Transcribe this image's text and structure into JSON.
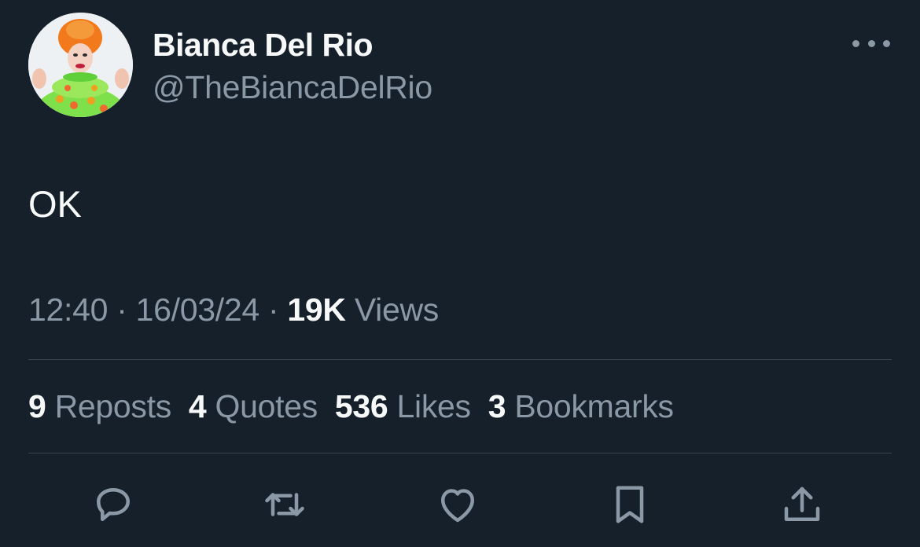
{
  "author": {
    "display_name": "Bianca Del Rio",
    "handle": "@TheBiancaDelRio"
  },
  "tweet": {
    "text": "OK",
    "time": "12:40",
    "date": "16/03/24",
    "separator": "·",
    "views_count": "19K",
    "views_label": "Views"
  },
  "stats": [
    {
      "count": "9",
      "label": "Reposts"
    },
    {
      "count": "4",
      "label": "Quotes"
    },
    {
      "count": "536",
      "label": "Likes"
    },
    {
      "count": "3",
      "label": "Bookmarks"
    }
  ],
  "actions": [
    {
      "name": "reply",
      "icon": "reply-icon"
    },
    {
      "name": "repost",
      "icon": "repost-icon"
    },
    {
      "name": "like",
      "icon": "heart-icon"
    },
    {
      "name": "bookmark",
      "icon": "bookmark-icon"
    },
    {
      "name": "share",
      "icon": "share-icon"
    }
  ],
  "colors": {
    "background": "#15202b",
    "primary_text": "#f7f9f9",
    "secondary_text": "#8b98a5",
    "divider": "#38444d"
  }
}
